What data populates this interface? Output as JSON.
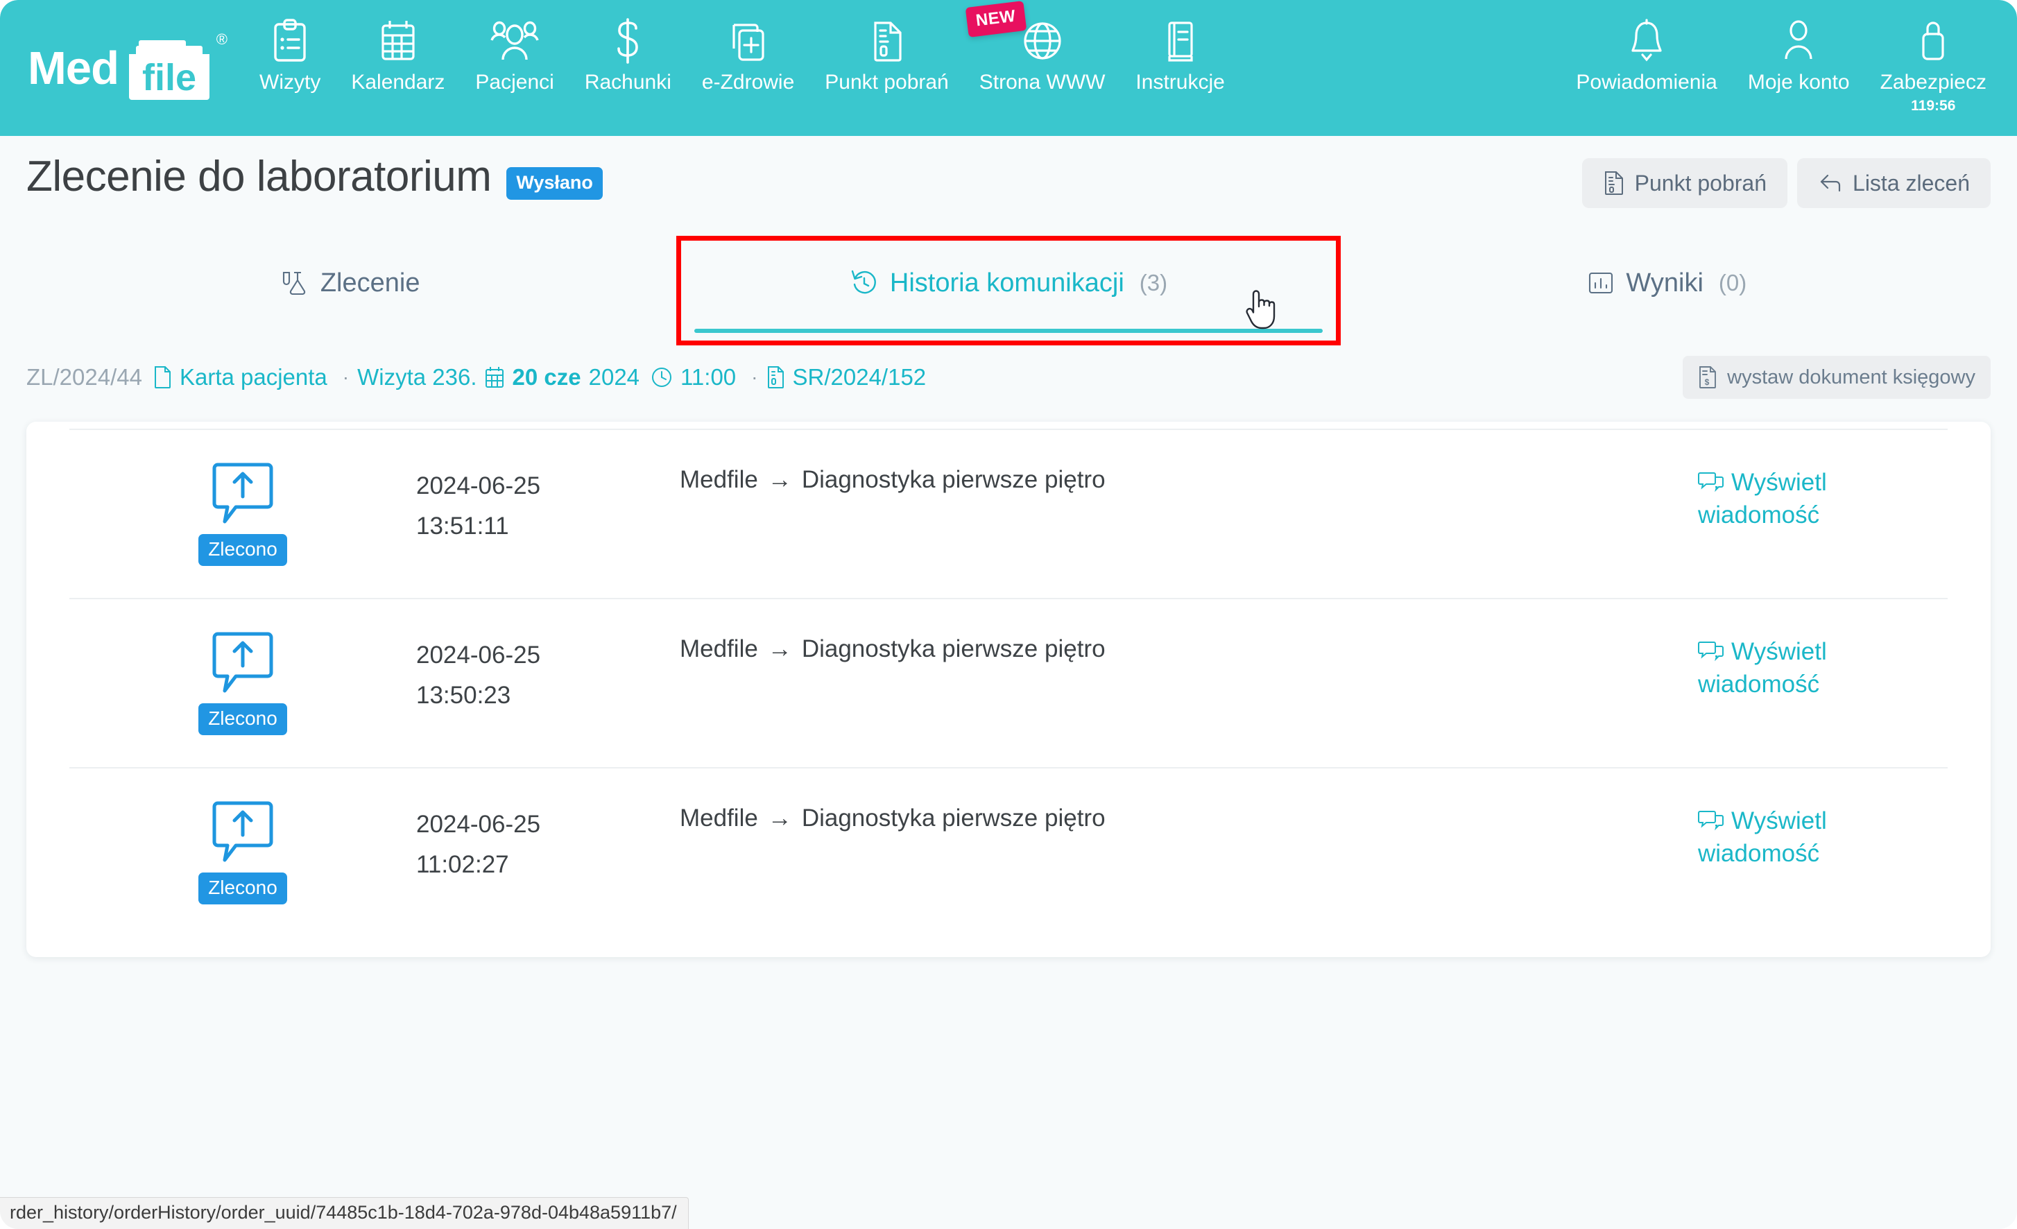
{
  "brand": {
    "word_med": "Med",
    "word_file": "file",
    "registered_mark": "®"
  },
  "topnav": {
    "left_items": [
      {
        "label": "Wizyty",
        "icon": "clipboard-icon"
      },
      {
        "label": "Kalendarz",
        "icon": "calendar-icon"
      },
      {
        "label": "Pacjenci",
        "icon": "users-icon"
      },
      {
        "label": "Rachunki",
        "icon": "dollar-icon"
      },
      {
        "label": "e-Zdrowie",
        "icon": "medical-file-icon"
      },
      {
        "label": "Punkt pobrań",
        "icon": "document-icon"
      },
      {
        "label": "Strona WWW",
        "icon": "globe-icon",
        "badge": "NEW"
      },
      {
        "label": "Instrukcje",
        "icon": "book-icon"
      }
    ],
    "right_items": [
      {
        "label": "Powiadomienia",
        "icon": "bell-icon"
      },
      {
        "label": "Moje konto",
        "icon": "user-icon"
      },
      {
        "label": "Zabezpiecz",
        "icon": "lock-icon",
        "sub": "119:56"
      }
    ]
  },
  "header": {
    "title": "Zlecenie do laboratorium",
    "status_badge": "Wysłano",
    "status_badge_color": "#2196e3",
    "actions": [
      {
        "label": "Punkt pobrań",
        "icon": "document-icon"
      },
      {
        "label": "Lista zleceń",
        "icon": "back-arrow-icon"
      }
    ]
  },
  "tabs": [
    {
      "label": "Zlecenie",
      "icon": "flask-icon",
      "count": "",
      "active": false,
      "highlighted": false
    },
    {
      "label": "Historia komunikacji",
      "icon": "history-icon",
      "count": "(3)",
      "active": true,
      "highlighted": true
    },
    {
      "label": "Wyniki",
      "icon": "chart-icon",
      "count": "(0)",
      "active": false,
      "highlighted": false
    }
  ],
  "meta": {
    "order_id": "ZL/2024/44",
    "patient_card_link": "Karta pacjenta",
    "separator": "·",
    "visit": "Wizyta 236.",
    "date": "20 cze",
    "year": "2024",
    "time": "11:00",
    "document_id": "SR/2024/152",
    "accounting_button": "wystaw dokument księgowy"
  },
  "history_rows": [
    {
      "status_tag": "Zlecono",
      "date": "2024-06-25",
      "time": "13:51:11",
      "from": "Medfile",
      "arrow": "→",
      "to": "Diagnostyka pierwsze piętro",
      "action_line1": "Wyświetl",
      "action_line2": "wiadomość"
    },
    {
      "status_tag": "Zlecono",
      "date": "2024-06-25",
      "time": "13:50:23",
      "from": "Medfile",
      "arrow": "→",
      "to": "Diagnostyka pierwsze piętro",
      "action_line1": "Wyświetl",
      "action_line2": "wiadomość"
    },
    {
      "status_tag": "Zlecono",
      "date": "2024-06-25",
      "time": "11:02:27",
      "from": "Medfile",
      "arrow": "→",
      "to": "Diagnostyka pierwsze piętro",
      "action_line1": "Wyświetl",
      "action_line2": "wiadomość"
    }
  ],
  "statusbar": {
    "url": "rder_history/orderHistory/order_uuid/74485c1b-18d4-702a-978d-04b48a5911b7/"
  },
  "colors": {
    "brand_teal": "#3ac7ce",
    "accent_teal": "#1ab7c8",
    "badge_blue": "#2196e3",
    "badge_pink": "#e8105f",
    "highlight_red": "#ff0000",
    "page_bg": "#f7fafb"
  }
}
